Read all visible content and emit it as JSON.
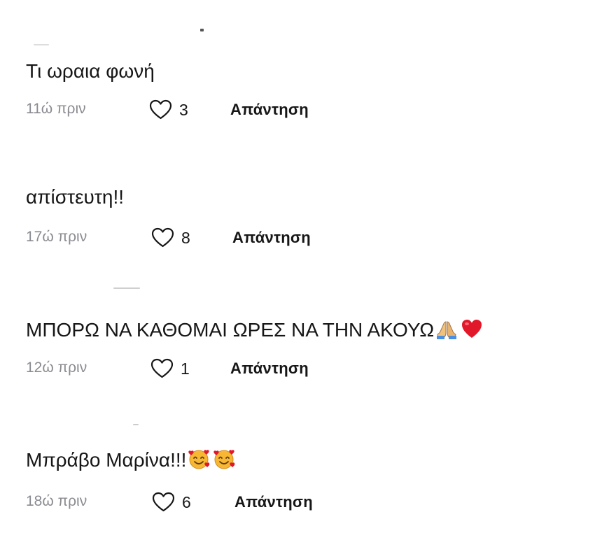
{
  "comments": [
    {
      "text": "Τι ωραια φωνή",
      "time": "11ώ πριν",
      "likes": "3",
      "reply_label": "Απάντηση",
      "emojis": []
    },
    {
      "text": "απίστευτη!!",
      "time": "17ώ πριν",
      "likes": "8",
      "reply_label": "Απάντηση",
      "emojis": []
    },
    {
      "text": "ΜΠΟΡΩ ΝΑ ΚΑΘΟΜΑΙ ΩΡΕΣ ΝΑ ΤΗΝ ΑΚΟΥΩ",
      "time": "12ώ πριν",
      "likes": "1",
      "reply_label": "Απάντηση",
      "emojis": [
        "folded-hands-icon",
        "red-heart-icon"
      ]
    },
    {
      "text": "Μπράβο Μαρίνα!!!",
      "time": "18ώ πριν",
      "likes": "6",
      "reply_label": "Απάντηση",
      "emojis": [
        "smiling-face-with-hearts-icon",
        "smiling-face-with-hearts-icon"
      ]
    }
  ],
  "colors": {
    "text": "#161616",
    "muted": "#8a8b91",
    "heart_red": "#e0182a",
    "emoji_yellow": "#f7b733"
  }
}
